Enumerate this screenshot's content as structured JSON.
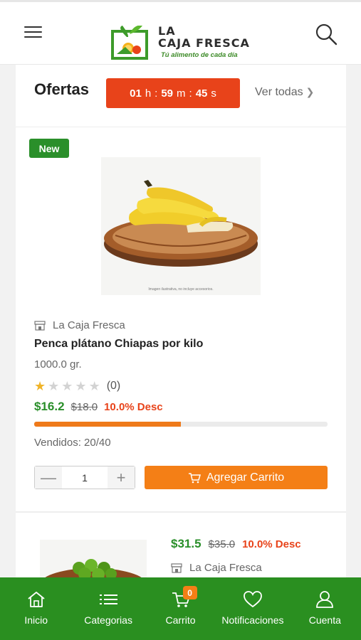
{
  "header": {
    "menu_icon": "hamburger-menu-icon",
    "logo_line1": "LA",
    "logo_line2": "CAJA FRESCA",
    "logo_tagline": "Tú alimento de cada día",
    "search_icon": "search-icon"
  },
  "offers": {
    "title": "Ofertas",
    "timer": {
      "hours": "01",
      "h": "h",
      "minutes": "59",
      "m": "m",
      "seconds": "45",
      "s": "s"
    },
    "see_all": "Ver todas",
    "accent": "#e8431a"
  },
  "product": {
    "badge": "New",
    "image_caption": "Imagen ilustrativa, no incluye accesorios.",
    "store": "La Caja Fresca",
    "name": "Penca plátano Chiapas por kilo",
    "weight": "1000.0 gr.",
    "rating": 1,
    "rating_max": 5,
    "rating_count": "(0)",
    "price": "$16.2",
    "old_price": "$18.0",
    "discount": "10.0% Desc",
    "sold_fraction": 0.5,
    "sold_text": "Vendidos: 20/40",
    "quantity": "1",
    "add_to_cart": "Agregar Carrito"
  },
  "product2": {
    "price": "$31.5",
    "old_price": "$35.0",
    "discount": "10.0% Desc",
    "store": "La Caja Fresca"
  },
  "nav": {
    "items": [
      {
        "label": "Inicio",
        "icon": "home-icon"
      },
      {
        "label": "Categorias",
        "icon": "list-icon"
      },
      {
        "label": "Carrito",
        "icon": "cart-icon",
        "badge": "0"
      },
      {
        "label": "Notificaciones",
        "icon": "heart-icon"
      },
      {
        "label": "Cuenta",
        "icon": "user-icon"
      }
    ],
    "color": "#2a8f20"
  }
}
